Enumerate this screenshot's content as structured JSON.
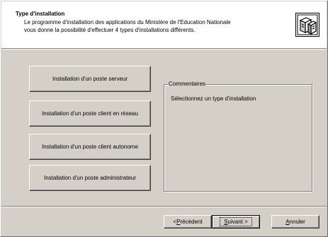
{
  "header": {
    "title": "Type d'installation",
    "description_line1": "Le programme d'installation des applications du Ministère de l'Education Nationale",
    "description_line2": "vous donne la possibilité d'effectuer 4 types d'installations différents.",
    "icon": "setup-computer-icon"
  },
  "choices": [
    {
      "label": "Installation d'un poste serveur"
    },
    {
      "label": "Installation d'un poste client en réseau"
    },
    {
      "label": "Installation d'un poste client autonome"
    },
    {
      "label": "Installation d'un poste administrateur"
    }
  ],
  "comments": {
    "legend": "Commentaires",
    "text": "Sélectionnez un type d'installation"
  },
  "footer": {
    "back_prefix": "< ",
    "back_access": "P",
    "back_rest": "récédent",
    "next_access": "S",
    "next_rest": "uivant >",
    "cancel_access": "A",
    "cancel_rest": "nnuler"
  },
  "colors": {
    "dialog_bg": "#d4d0c8",
    "header_bg": "#ffffff"
  }
}
